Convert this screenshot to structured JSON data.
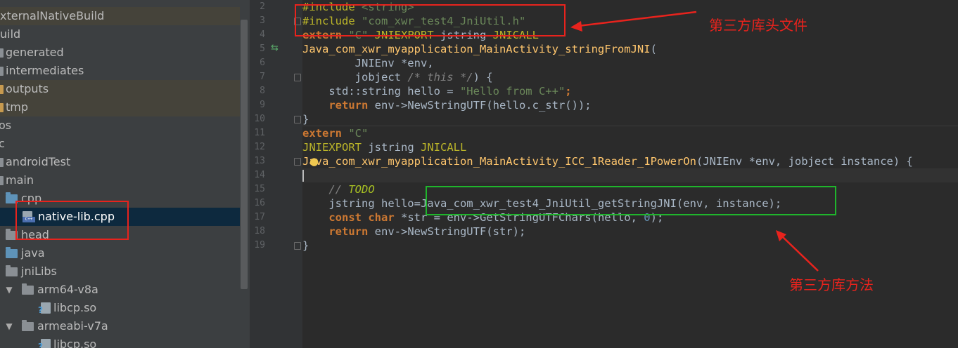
{
  "tree": {
    "rows": [
      {
        "label": "xternalNativeBuild"
      },
      {
        "label": "uild"
      },
      {
        "label": "generated"
      },
      {
        "label": "intermediates"
      },
      {
        "label": "outputs"
      },
      {
        "label": "tmp"
      },
      {
        "label": "os"
      },
      {
        "label": "c"
      },
      {
        "label": "androidTest"
      },
      {
        "label": "main"
      },
      {
        "label": "cpp"
      },
      {
        "label": "native-lib.cpp",
        "badge": "C++"
      },
      {
        "label": "head"
      },
      {
        "label": "java"
      },
      {
        "label": "jniLibs"
      },
      {
        "label": "arm64-v8a",
        "arrow": "▼"
      },
      {
        "label": "libcp.so"
      },
      {
        "label": "armeabi-v7a",
        "arrow": "▼"
      },
      {
        "label": "libcp.so"
      }
    ]
  },
  "gutter": {
    "line_numbers": [
      "2",
      "3",
      "4",
      "5",
      "6",
      "7",
      "8",
      "9",
      "10",
      "11",
      "12",
      "13",
      "14",
      "15",
      "16",
      "17",
      "18",
      "19"
    ],
    "run_icon": "⇆"
  },
  "editor": {
    "l2": {
      "a": "#include",
      "b": " <string>"
    },
    "l3": {
      "a": "#include",
      "b": " \"com_xwr_test4_JniUtil.h\""
    },
    "l4": {
      "a": "extern",
      "b": " \"C\"",
      "c": " JNIEXPORT",
      "d": " jstring ",
      "e": "JNICALL"
    },
    "l5": {
      "a": "Java_com_xwr_myapplication_MainActivity_stringFromJNI",
      "b": "("
    },
    "l6": {
      "a": "        JNIEnv *env,"
    },
    "l7": {
      "a": "        jobject ",
      "b": "/* this */",
      "c": ") {"
    },
    "l8": {
      "a": "    std::string hello = ",
      "b": "\"Hello from C++\"",
      "c": ";"
    },
    "l9": {
      "a": "    ",
      "b": "return",
      "c": " env->NewStringUTF(hello.c_str());"
    },
    "l10": {
      "a": "}"
    },
    "l11": {
      "a": "extern",
      "b": " \"C\""
    },
    "l12": {
      "a": "JNIEXPORT",
      "b": " jstring ",
      "c": "JNICALL"
    },
    "l13": {
      "a": "Java_com_xwr_myapplication_MainActivity_ICC_1Reader_1PowerOn",
      "b": "(JNIEnv *env, jobject instance) {"
    },
    "l15": {
      "a": "    ",
      "b": "// ",
      "c": "TODO"
    },
    "l16": {
      "a": "    jstring hello=Java_com_xwr_test4_JniUtil_getStringJNI(env, instance);"
    },
    "l17": {
      "a": "    ",
      "b": "const",
      "c": " ",
      "d": "char",
      "e": " *str = env->GetStringUTFChars(hello, ",
      "f": "0",
      "g": ");"
    },
    "l18": {
      "a": "    ",
      "b": "return",
      "c": " env->NewStringUTF(str);"
    },
    "l19": {
      "a": "}"
    }
  },
  "annotations": {
    "header_note": "第三方库头文件",
    "method_note": "第三方库方法",
    "color_red": "#e8231d",
    "color_green": "#1fb52c"
  }
}
